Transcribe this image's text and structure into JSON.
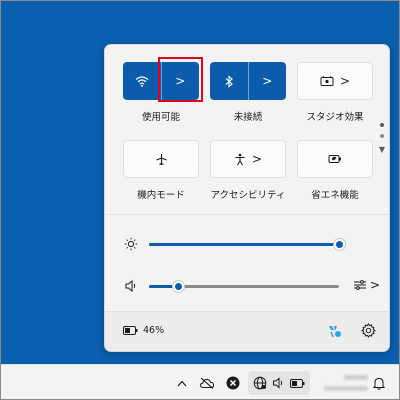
{
  "quick_settings": {
    "tiles": [
      {
        "label": "使用可能",
        "state": "on",
        "icon": "wifi-icon"
      },
      {
        "label": "未接続",
        "state": "on",
        "icon": "bluetooth-icon"
      },
      {
        "label": "スタジオ効果",
        "state": "off",
        "icon": "studio-effects-icon"
      },
      {
        "label": "機内モード",
        "state": "off",
        "icon": "airplane-icon"
      },
      {
        "label": "アクセシビリティ",
        "state": "off",
        "icon": "accessibility-icon"
      },
      {
        "label": "省エネ機能",
        "state": "off",
        "icon": "energy-saver-icon"
      }
    ],
    "chevron": ">",
    "page_arrow": "▼"
  },
  "sliders": {
    "brightness": {
      "icon": "brightness-icon",
      "value": 100
    },
    "volume": {
      "icon": "speaker-icon",
      "value": 15
    }
  },
  "footer": {
    "battery_percent": "46%",
    "battery_icon": "battery-icon",
    "accessibility_icon": "accessibility-tray-icon",
    "settings_icon": "gear-icon"
  },
  "taskbar": {
    "overflow_chevron": "^",
    "icons": [
      "chevron-up-icon",
      "cloud-offline-icon",
      "x-circle-icon",
      "globe-icon",
      "speaker-icon",
      "battery-icon",
      "bell-icon"
    ]
  },
  "colors": {
    "accent": "#0b5cad",
    "desktop": "#0a5fb0",
    "highlight_box": "#e2001a"
  }
}
